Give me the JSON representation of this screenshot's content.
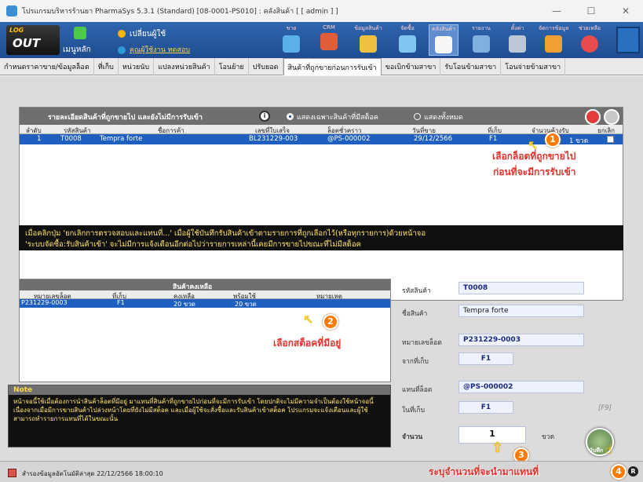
{
  "window": {
    "title": "โปรแกรมบริหารร้านยา PharmaSys 5.3.1 (Standard) [08-0001-PS010] : คลังสินค้า [ [ admin ] ]",
    "min": "—",
    "max": "☐",
    "close": "✕"
  },
  "ribbon": {
    "logout_top": "LOG",
    "logout_bottom": "OUT",
    "main_menu": "เมนูหลัก",
    "change_user": "เปลี่ยนผู้ใช้",
    "current_user": "คุณผู้ใช้งาน ทดสอบ",
    "buttons": [
      {
        "label": "ขาย"
      },
      {
        "label": "CRM"
      },
      {
        "label": "ข้อมูลสินค้า"
      },
      {
        "label": "จัดซื้อ"
      },
      {
        "label": "คลังสินค้า"
      },
      {
        "label": "รายงาน"
      },
      {
        "label": "ตั้งค่า"
      },
      {
        "label": "จัดการข้อมูล"
      },
      {
        "label": "ช่วยเหลือ"
      }
    ]
  },
  "tabs": [
    "กำหนดราคาขาย/ข้อมูลล็อต",
    "ที่เก็บ",
    "หน่วยนับ",
    "แปลงหน่วยสินค้า",
    "โอนย้าย",
    "ปรับยอด",
    "สินค้าที่ถูกขายก่อนการรับเข้า",
    "ขอเบิกข้ามสาขา",
    "รับโอนข้ามสาขา",
    "โอนจ่ายข้ามสาขา"
  ],
  "panel1": {
    "title": "รายละเอียดสินค้าที่ถูกขายไป และยังไม่มีการรับเข้า",
    "info_icon": "i",
    "radio_stock": "แสดงเฉพาะสินค้าที่มีสต็อค",
    "radio_all": "แสดงทั้งหมด",
    "columns": [
      "ลำดับ",
      "รหัสสินค้า",
      "ชื่อการค้า",
      "เลขที่ใบเสร็จ",
      "ล็อตชั่วคราว",
      "วันที่ขาย",
      "ที่เก็บ",
      "จำนวนค้างรับ",
      "ยกเลิก"
    ],
    "row": {
      "no": "1",
      "code": "T0008",
      "name": "Tempra forte",
      "receipt": "BL231229-003",
      "lot": "@PS-000002",
      "date": "29/12/2566",
      "loc": "F1",
      "qty": "1 ขวด"
    }
  },
  "callouts": {
    "step1_line1": "เลือกล็อตที่ถูกขายไป",
    "step1_line2": "ก่อนที่จะมีการรับเข้า",
    "step2": "เลือกสต็อคที่มีอยู่",
    "step3": "ระบุจำนวนที่จะนำมาแทนที่",
    "n1": "1",
    "n2": "2",
    "n3": "3",
    "n4": "4"
  },
  "info_bar": {
    "line1": "เมื่อคลิกปุ่ม 'ยกเลิกการตรวจสอบและแทนที่...' เมื่อผู้ใช้บันทึกรับสินค้าเข้าตามรายการที่ถูกเลือกไว้(หรือทุกรายการ)ด้วยหน้าจอ",
    "line2": "'ระบบจัดซื้อ:รับสินค้าเข้า' จะไม่มีการแจ้งเตือนอีกต่อไปว่ารายการเหล่านี้เคยมีการขายไปขณะที่ไม่มีสต็อค"
  },
  "panel2": {
    "title": "สินค้าคงเหลือ",
    "columns": [
      "หมายเลขล็อต",
      "ที่เก็บ",
      "คงเหลือ",
      "พร้อมใช้",
      "หมายเหตุ"
    ],
    "row": {
      "lot": "P231229-0003",
      "loc": "F1",
      "remain": "20 ขวด",
      "ready": "20 ขวด",
      "note": ""
    }
  },
  "note": {
    "title": "Note",
    "text": "หน้าจอนี้ใช้เมื่อต้องการนำสินค้าล็อตที่มีอยู่ มาแทนที่สินค้าที่ถูกขายไปก่อนที่จะมีการรับเข้า โดยปกติจะไม่มีความจำเป็นต้องใช้หน้าจอนี้ เนื่องจากเมื่อมีการขายสินค้าไปล่วงหน้าโดยที่ยังไม่มีสต็อค และเมื่อผู้ใช้จะสั่งซื้อและรับสินค้าเข้าสต็อค โปรแกรมจะแจ้งเตือนและผู้ใช้สามารถทำรายการแทนที่ได้ในขณะนั้น"
  },
  "form": {
    "code_label": "รหัสสินค้า",
    "code": "T0008",
    "name_label": "ชื่อสินค้า",
    "name": "Tempra forte",
    "lot_label": "หมายเลขล็อต",
    "lot": "P231229-0003",
    "from_label": "จากที่เก็บ",
    "from": "F1",
    "replace_label": "แทนที่ล็อต",
    "replace": "@PS-000002",
    "in_label": "ในที่เก็บ",
    "in": "F1",
    "f9": "[F9]",
    "qty_label": "จำนวน",
    "qty": "1",
    "unit": "ขวด",
    "save": "บันทึก"
  },
  "status": {
    "text": "สำรองข้อมูลอัตโนมัติล่าสุด 22/12/2566 18:00:10",
    "r": "R"
  }
}
